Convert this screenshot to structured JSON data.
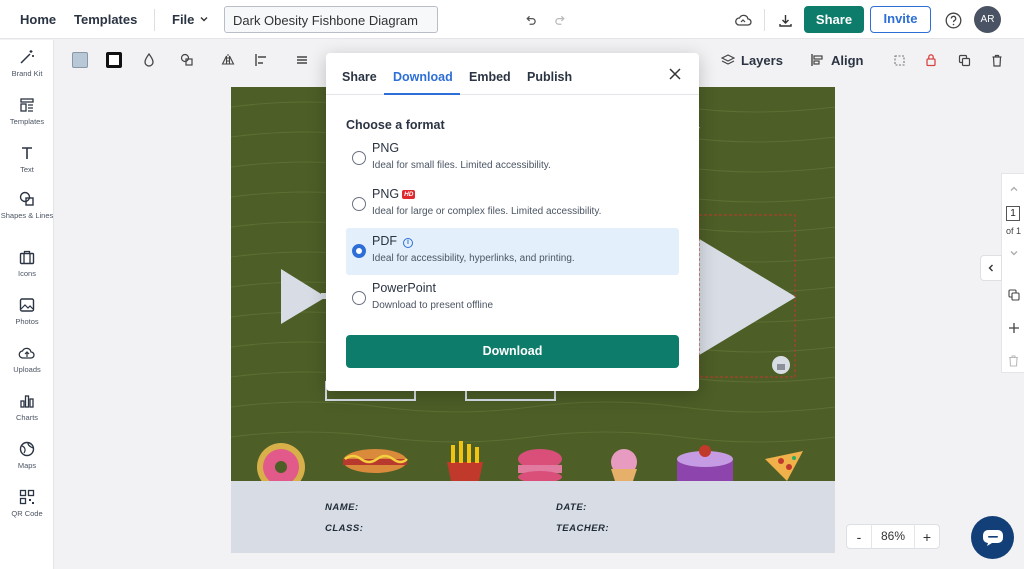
{
  "topbar": {
    "home": "Home",
    "templates": "Templates",
    "file": "File",
    "document_title": "Dark Obesity Fishbone Diagram",
    "share": "Share",
    "invite": "Invite",
    "avatar_initials": "AR"
  },
  "sidebar": {
    "items": [
      {
        "label": "Brand Kit",
        "icon": "magic-wand-icon"
      },
      {
        "label": "Templates",
        "icon": "templates-icon"
      },
      {
        "label": "Text",
        "icon": "text-icon"
      },
      {
        "label": "Shapes & Lines",
        "icon": "shapes-icon"
      },
      {
        "label": "Icons",
        "icon": "briefcase-icon"
      },
      {
        "label": "Photos",
        "icon": "image-icon"
      },
      {
        "label": "Uploads",
        "icon": "upload-cloud-icon"
      },
      {
        "label": "Charts",
        "icon": "bar-chart-icon"
      },
      {
        "label": "Maps",
        "icon": "globe-icon"
      },
      {
        "label": "QR Code",
        "icon": "qr-code-icon"
      }
    ]
  },
  "toolbar": {
    "layers": "Layers",
    "align": "Align"
  },
  "canvas": {
    "name_label": "NAME:",
    "date_label": "DATE:",
    "class_label": "CLASS:",
    "teacher_label": "TEACHER:"
  },
  "pager": {
    "page": "1",
    "of": "of 1"
  },
  "zoom": {
    "minus": "-",
    "value": "86%",
    "plus": "+"
  },
  "modal": {
    "tabs": [
      "Share",
      "Download",
      "Embed",
      "Publish"
    ],
    "active_tab": "Download",
    "choose_format": "Choose a format",
    "options": [
      {
        "title": "PNG",
        "description": "Ideal for small files. Limited accessibility.",
        "selected": false
      },
      {
        "title": "PNG",
        "badge": "HD",
        "description": "Ideal for large or complex files. Limited accessibility.",
        "selected": false
      },
      {
        "title": "PDF",
        "description": "Ideal for accessibility, hyperlinks, and printing.",
        "selected": true
      },
      {
        "title": "PowerPoint",
        "description": "Download to present offline",
        "selected": false
      }
    ],
    "download_button": "Download"
  },
  "colors": {
    "accent_teal": "#0e7c6b",
    "accent_blue": "#2d6fd6",
    "canvas_green": "#4d5e27"
  }
}
